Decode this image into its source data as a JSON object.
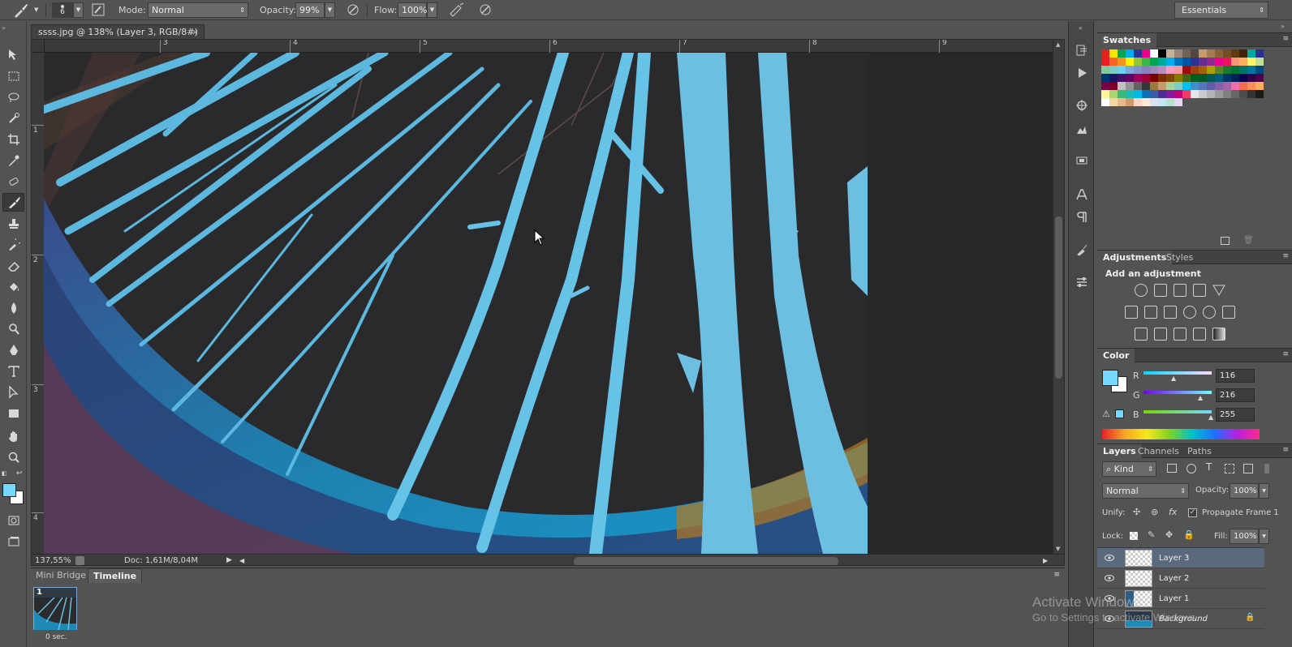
{
  "options_bar": {
    "brush_size": "6",
    "mode_label": "Mode:",
    "mode_value": "Normal",
    "opacity_label": "Opacity:",
    "opacity_value": "99%",
    "flow_label": "Flow:",
    "flow_value": "100%",
    "workspace": "Essentials"
  },
  "document": {
    "tab_title": "ssss.jpg @ 138% (Layer 3, RGB/8#) *",
    "tab_close": "×",
    "ruler_h": [
      "3",
      "4",
      "5",
      "6",
      "7",
      "8",
      "9"
    ],
    "ruler_v": [
      "1",
      "2",
      "3",
      "4"
    ],
    "zoom": "137,55%",
    "doc_size": "Doc: 1,61M/8,04M"
  },
  "bottom_panel": {
    "tabs": [
      "Mini Bridge",
      "Timeline"
    ],
    "frame_number": "1",
    "frame_delay": "0 sec."
  },
  "swatches": {
    "title": "Swatches",
    "colors": [
      "#e2231a",
      "#f7e600",
      "#00a651",
      "#00aeef",
      "#2e3192",
      "#ec008c",
      "#ffffff",
      "#000000",
      "#c7b299",
      "#998675",
      "#736357",
      "#534741",
      "#c69c6d",
      "#a67c52",
      "#8c6239",
      "#754c24",
      "#603913",
      "#42210b",
      "#00a99d",
      "#2e3192",
      "#ed1c24",
      "#f26522",
      "#f7941d",
      "#fff200",
      "#8dc63f",
      "#39b54a",
      "#00a651",
      "#00a99d",
      "#00aeef",
      "#0072bc",
      "#0054a6",
      "#2e3192",
      "#662d91",
      "#92278f",
      "#ec008c",
      "#ed145b",
      "#f69679",
      "#fbaf5d",
      "#fff568",
      "#c4df9b",
      "#82ca9c",
      "#7accc8",
      "#6dcff6",
      "#7da7d9",
      "#8393ca",
      "#8781bd",
      "#a186be",
      "#bd8cbf",
      "#f49ac1",
      "#f6989d",
      "#9e0b0f",
      "#a0410d",
      "#a36209",
      "#aba000",
      "#598527",
      "#1a7b30",
      "#007236",
      "#00746b",
      "#0076a3",
      "#004a80",
      "#003471",
      "#1b1464",
      "#440e62",
      "#630460",
      "#9e005d",
      "#9e0039",
      "#790000",
      "#7b2e00",
      "#7d4900",
      "#827b00",
      "#406618",
      "#005e20",
      "#005826",
      "#005952",
      "#005b7f",
      "#003663",
      "#002157",
      "#0d004c",
      "#32004b",
      "#4b0049",
      "#7b0046",
      "#7a0026",
      "#c2c2c2",
      "#959595",
      "#626262",
      "#363636",
      "#9c7a3c",
      "#c69c6d",
      "#a3d39c",
      "#7bcdc8",
      "#00bff3",
      "#448ccb",
      "#5674b9",
      "#605ca8",
      "#855fa8",
      "#a763a8",
      "#f06eaa",
      "#f26c4f",
      "#f68e56",
      "#fbaf5d",
      "#fff799",
      "#acd372",
      "#3cb878",
      "#1cbbb4",
      "#00b7eb",
      "#0a6fb3",
      "#3d5aa8",
      "#4c2c92",
      "#87189d",
      "#c1007c",
      "#ee3b64",
      "#e6e6e6",
      "#cccccc",
      "#b3b3b3",
      "#999999",
      "#808080",
      "#666666",
      "#4d4d4d",
      "#333333",
      "#1a1a1a",
      "#ffffff",
      "#f5d5a4",
      "#e8b98b",
      "#cf9a6c",
      "#ffd3c8",
      "#ffe8d6",
      "#d9e3f0",
      "#c3e6f5",
      "#b7e1cd",
      "#e5d9f2"
    ]
  },
  "adjustments": {
    "tabs": [
      "Adjustments",
      "Styles"
    ],
    "heading": "Add an adjustment"
  },
  "color_panel": {
    "title": "Color",
    "channels": [
      {
        "label": "R",
        "value": "116"
      },
      {
        "label": "G",
        "value": "216"
      },
      {
        "label": "B",
        "value": "255"
      }
    ],
    "foreground": "#74d8ff",
    "background": "#ffffff"
  },
  "layers": {
    "tabs": [
      "Layers",
      "Channels",
      "Paths"
    ],
    "filter_kind": "Kind",
    "blend_mode": "Normal",
    "opacity_label": "Opacity:",
    "opacity_value": "100%",
    "unify_label": "Unify:",
    "propagate_label": "Propagate Frame 1",
    "lock_label": "Lock:",
    "fill_label": "Fill:",
    "fill_value": "100%",
    "items": [
      {
        "name": "Layer 3",
        "selected": true
      },
      {
        "name": "Layer 2",
        "selected": false
      },
      {
        "name": "Layer 1",
        "selected": false
      },
      {
        "name": "Background",
        "selected": false
      }
    ]
  },
  "watermark": {
    "line1": "Activate Windows",
    "line2": "Go to Settings to activate Windows."
  }
}
